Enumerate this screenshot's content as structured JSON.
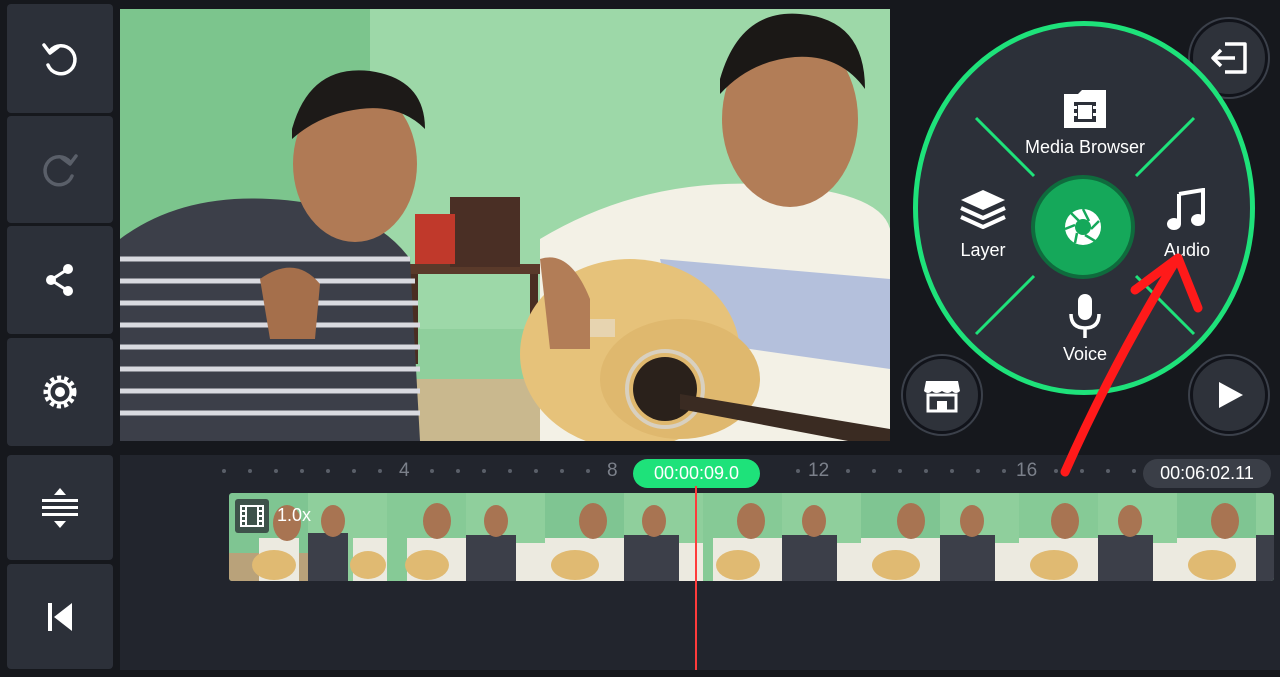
{
  "sidebar": {
    "buttons": [
      {
        "icon": "undo-icon"
      },
      {
        "icon": "redo-icon"
      },
      {
        "icon": "share-icon"
      },
      {
        "icon": "settings-gear-icon"
      },
      {
        "icon": "timeline-expand-icon"
      },
      {
        "icon": "skip-to-start-icon"
      }
    ]
  },
  "wheel": {
    "media_browser_label": "Media Browser",
    "layer_label": "Layer",
    "audio_label": "Audio",
    "voice_label": "Voice",
    "accent_color": "#1ee27a"
  },
  "timeline": {
    "current_time": "00:00:09.0",
    "total_duration": "00:06:02.11",
    "ticks": [
      "4",
      "8",
      "12",
      "16"
    ],
    "clip_speed": "1.0x",
    "playhead_color": "#ff3b3b"
  },
  "annotation": {
    "arrow_color": "#ff1a1a"
  }
}
